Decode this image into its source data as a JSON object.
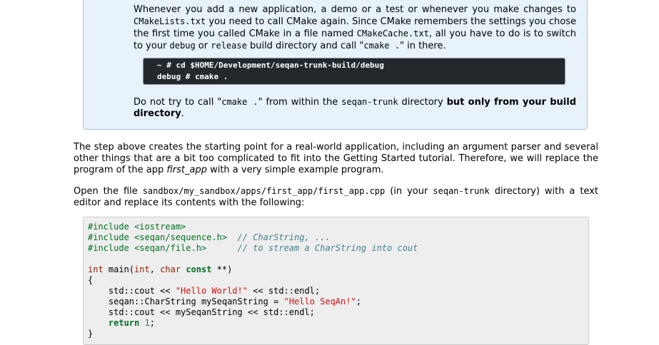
{
  "note": {
    "para1": {
      "t1": "Whenever you add a new application, a demo or a test or whenever you make changes to ",
      "c1": "CMakeLists.txt",
      "t2": " you need to call CMake again. Since CMake remembers the settings you chose the first time you called CMake in a file named ",
      "c2": "CMakeCache.txt",
      "t3": ", all you have to do is to switch to your ",
      "c3": "debug",
      "t4": " or ",
      "c4": "release",
      "t5": " build directory and call \"",
      "c5": "cmake .",
      "t6": "\" in there."
    },
    "terminal": {
      "line1": "~ # cd $HOME/Development/seqan-trunk-build/debug",
      "line2": "debug # cmake ."
    },
    "para2": {
      "t1": "Do not try to call \"",
      "c1": "cmake .",
      "t2": "\" from within the ",
      "c2": "seqan-trunk",
      "t3": " directory ",
      "bold": "but only from your build directory",
      "t4": "."
    }
  },
  "para_step": {
    "t1": "The step above creates the starting point for a real-world application, including an argument parser and several other things that are a bit too complicated to fit into the Getting Started tutorial. Therefore, we will replace the program of the app ",
    "em": "first_app",
    "t2": " with a very simple example program."
  },
  "para_open": {
    "t1": "Open the file ",
    "c1": "sandbox/my_sandbox/apps/first_app/first_app.cpp",
    "t2": " (in your ",
    "c2": "seqan-trunk",
    "t3": " directory) with a text editor and replace its contents with the following:"
  },
  "code": {
    "l1": "#include <iostream>",
    "l2a": "#include <seqan/sequence.h>  ",
    "l2b": "// CharString, ...",
    "l3a": "#include <seqan/file.h>      ",
    "l3b": "// to stream a CharString into cout",
    "l5a": "int",
    "l5b": " main(",
    "l5c": "int",
    "l5d": ", ",
    "l5e": "char",
    "l5f": " ",
    "l5g": "const",
    "l5h": " **)",
    "l6": "{",
    "l7a": "    std::cout << ",
    "l7b": "\"Hello World!\"",
    "l7c": " << std::endl;",
    "l8a": "    seqan::CharString mySeqanString = ",
    "l8b": "\"Hello SeqAn!\"",
    "l8c": ";",
    "l9": "    std::cout << mySeqanString << std::endl;",
    "l10a": "    ",
    "l10b": "return",
    "l10c": " ",
    "l10d": "1",
    "l10e": ";",
    "l11": "}"
  }
}
